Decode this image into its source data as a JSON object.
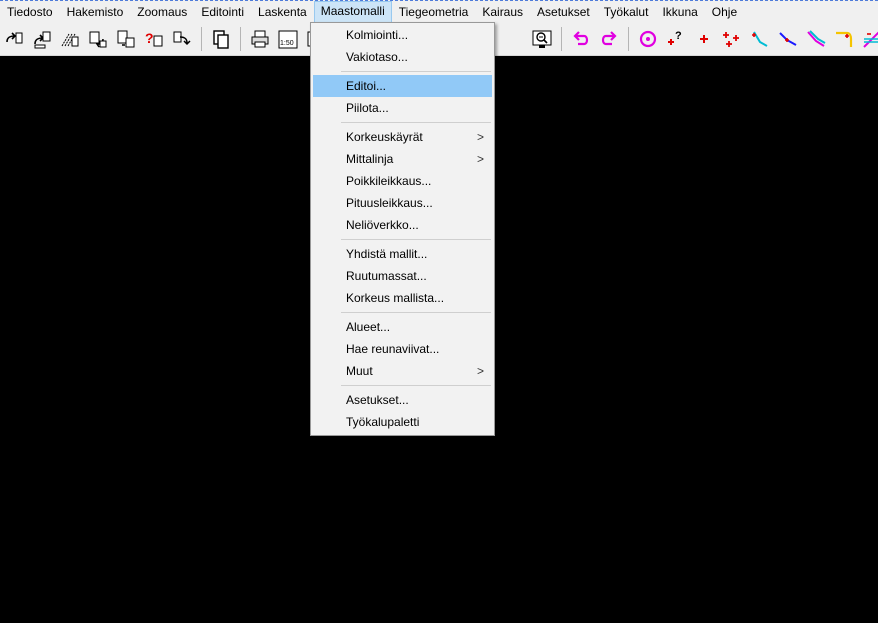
{
  "menubar": {
    "items": [
      "Tiedosto",
      "Hakemisto",
      "Zoomaus",
      "Editointi",
      "Laskenta",
      "Maastomalli",
      "Tiegeometria",
      "Kairaus",
      "Asetukset",
      "Työkalut",
      "Ikkuna",
      "Ohje"
    ],
    "active": "Maastomalli"
  },
  "toolbar": {
    "scale_label": "1:50"
  },
  "dropdown": {
    "groups": [
      [
        {
          "label": "Kolmiointi..."
        },
        {
          "label": "Vakiotaso..."
        }
      ],
      [
        {
          "label": "Editoi...",
          "highlighted": true
        },
        {
          "label": "Piilota..."
        }
      ],
      [
        {
          "label": "Korkeuskäyrät",
          "submenu": true
        },
        {
          "label": "Mittalinja",
          "submenu": true
        },
        {
          "label": "Poikkileikkaus..."
        },
        {
          "label": "Pituusleikkaus..."
        },
        {
          "label": "Neliöverkko..."
        }
      ],
      [
        {
          "label": "Yhdistä mallit..."
        },
        {
          "label": "Ruutumassat..."
        },
        {
          "label": "Korkeus mallista..."
        }
      ],
      [
        {
          "label": "Alueet..."
        },
        {
          "label": "Hae reunaviivat..."
        },
        {
          "label": "Muut",
          "submenu": true
        }
      ],
      [
        {
          "label": "Asetukset..."
        },
        {
          "label": "Työkalupaletti"
        }
      ]
    ],
    "submenu_arrow": ">"
  },
  "colors": {
    "highlight": "#91c9f7",
    "canvas": "#000000",
    "accent_magenta": "#e000e0",
    "accent_red": "#e00000"
  }
}
